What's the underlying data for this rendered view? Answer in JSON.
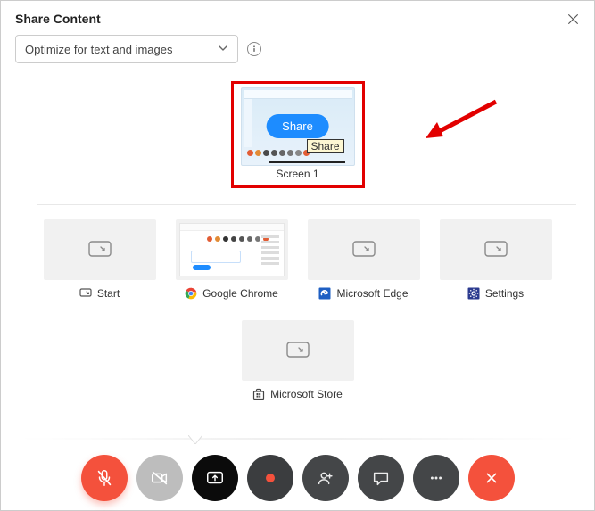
{
  "header": {
    "title": "Share Content"
  },
  "dropdown": {
    "label": "Optimize for text and images"
  },
  "featured": {
    "share_button": "Share",
    "tooltip": "Share",
    "label": "Screen 1"
  },
  "tiles": [
    {
      "label": "Start",
      "icon": "screen"
    },
    {
      "label": "Google Chrome",
      "icon": "chrome"
    },
    {
      "label": "Microsoft Edge",
      "icon": "edge"
    },
    {
      "label": "Settings",
      "icon": "settings"
    },
    {
      "label": "Microsoft Store",
      "icon": "store"
    }
  ],
  "callbar": {
    "mute": "muted-mic",
    "video": "video-off",
    "share": "share-screen",
    "record": "record",
    "participants": "participants",
    "chat": "chat",
    "more": "more",
    "end": "end-call"
  }
}
